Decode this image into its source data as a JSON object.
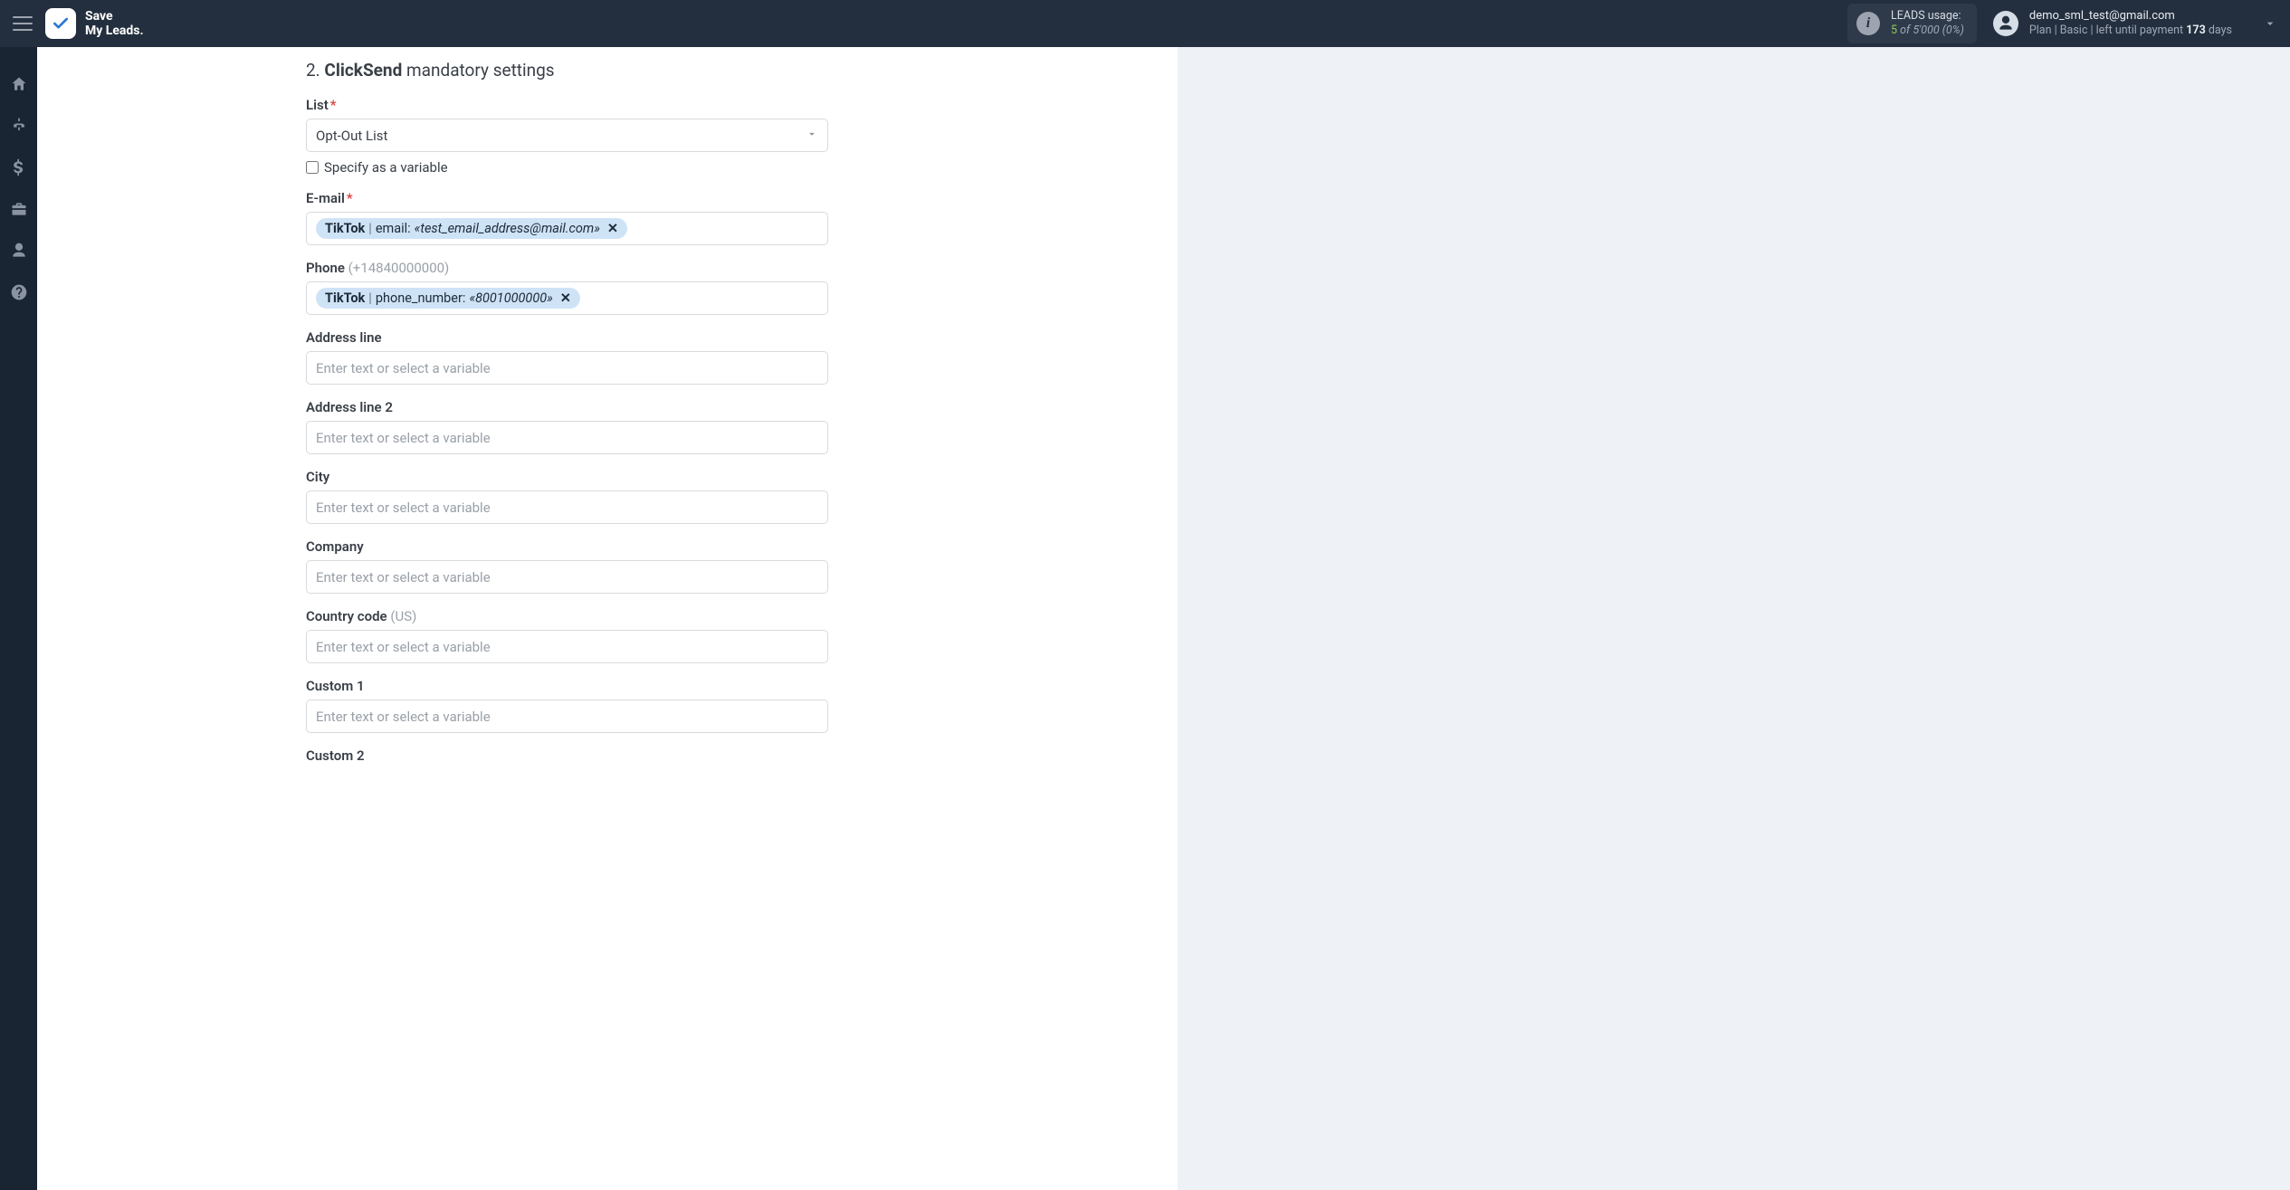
{
  "brand": {
    "line1": "Save",
    "line2": "My Leads."
  },
  "usage": {
    "title": "LEADS usage:",
    "count": "5",
    "of_word": "of",
    "limit": "5'000",
    "pct": "(0%)"
  },
  "account": {
    "email": "demo_sml_test@gmail.com",
    "plan_prefix": "Plan |",
    "plan_name": "Basic",
    "plan_mid": "| left until payment",
    "days": "173",
    "days_word": "days"
  },
  "section": {
    "num": "2.",
    "strong": "ClickSend",
    "rest": "mandatory settings"
  },
  "fields": {
    "list": {
      "label": "List",
      "value": "Opt-Out List",
      "variable_label": "Specify as a variable"
    },
    "email": {
      "label": "E-mail",
      "chip_source": "TikTok",
      "chip_key": "email:",
      "chip_value": "«test_email_address@mail.com»"
    },
    "phone": {
      "label": "Phone",
      "hint": "(+14840000000)",
      "chip_source": "TikTok",
      "chip_key": "phone_number:",
      "chip_value": "«8001000000»"
    },
    "address1": {
      "label": "Address line",
      "placeholder": "Enter text or select a variable"
    },
    "address2": {
      "label": "Address line 2",
      "placeholder": "Enter text or select a variable"
    },
    "city": {
      "label": "City",
      "placeholder": "Enter text or select a variable"
    },
    "company": {
      "label": "Company",
      "placeholder": "Enter text or select a variable"
    },
    "country": {
      "label": "Country code",
      "hint": "(US)",
      "placeholder": "Enter text or select a variable"
    },
    "custom1": {
      "label": "Custom 1",
      "placeholder": "Enter text or select a variable"
    },
    "custom2": {
      "label": "Custom 2"
    }
  }
}
